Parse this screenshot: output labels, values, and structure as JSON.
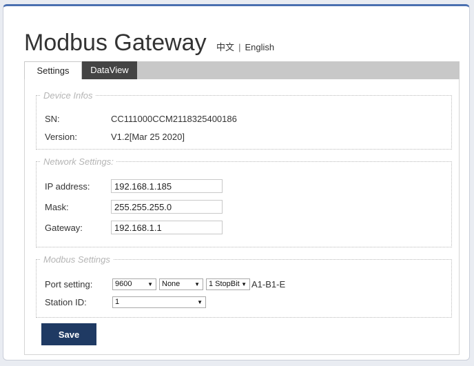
{
  "header": {
    "title": "Modbus Gateway",
    "lang_zh": "中文",
    "lang_sep": "|",
    "lang_en": "English"
  },
  "tabs": [
    {
      "label": "Settings",
      "active": true
    },
    {
      "label": "DataView",
      "active": false
    }
  ],
  "device": {
    "legend": "Device Infos",
    "sn_label": "SN:",
    "sn_value": "CC111000CCM2118325400186",
    "version_label": "Version:",
    "version_value": "V1.2[Mar 25 2020]"
  },
  "network": {
    "legend": "Network Settings:",
    "ip_label": "IP address:",
    "ip_value": "192.168.1.185",
    "mask_label": "Mask:",
    "mask_value": "255.255.255.0",
    "gateway_label": "Gateway:",
    "gateway_value": "192.168.1.1"
  },
  "modbus": {
    "legend": "Modbus Settings",
    "port_label": "Port setting:",
    "baud": "9600",
    "parity": "None",
    "stopbit": "1 StopBit",
    "port_suffix": "A1-B1-E",
    "station_label": "Station ID:",
    "station_value": "1"
  },
  "actions": {
    "save_label": "Save"
  },
  "colors": {
    "save_bg": "#1f3a63",
    "tab_inactive_bg": "#444444",
    "tabbar_bg": "#c8c8c8",
    "top_border": "#4a6fb0"
  }
}
